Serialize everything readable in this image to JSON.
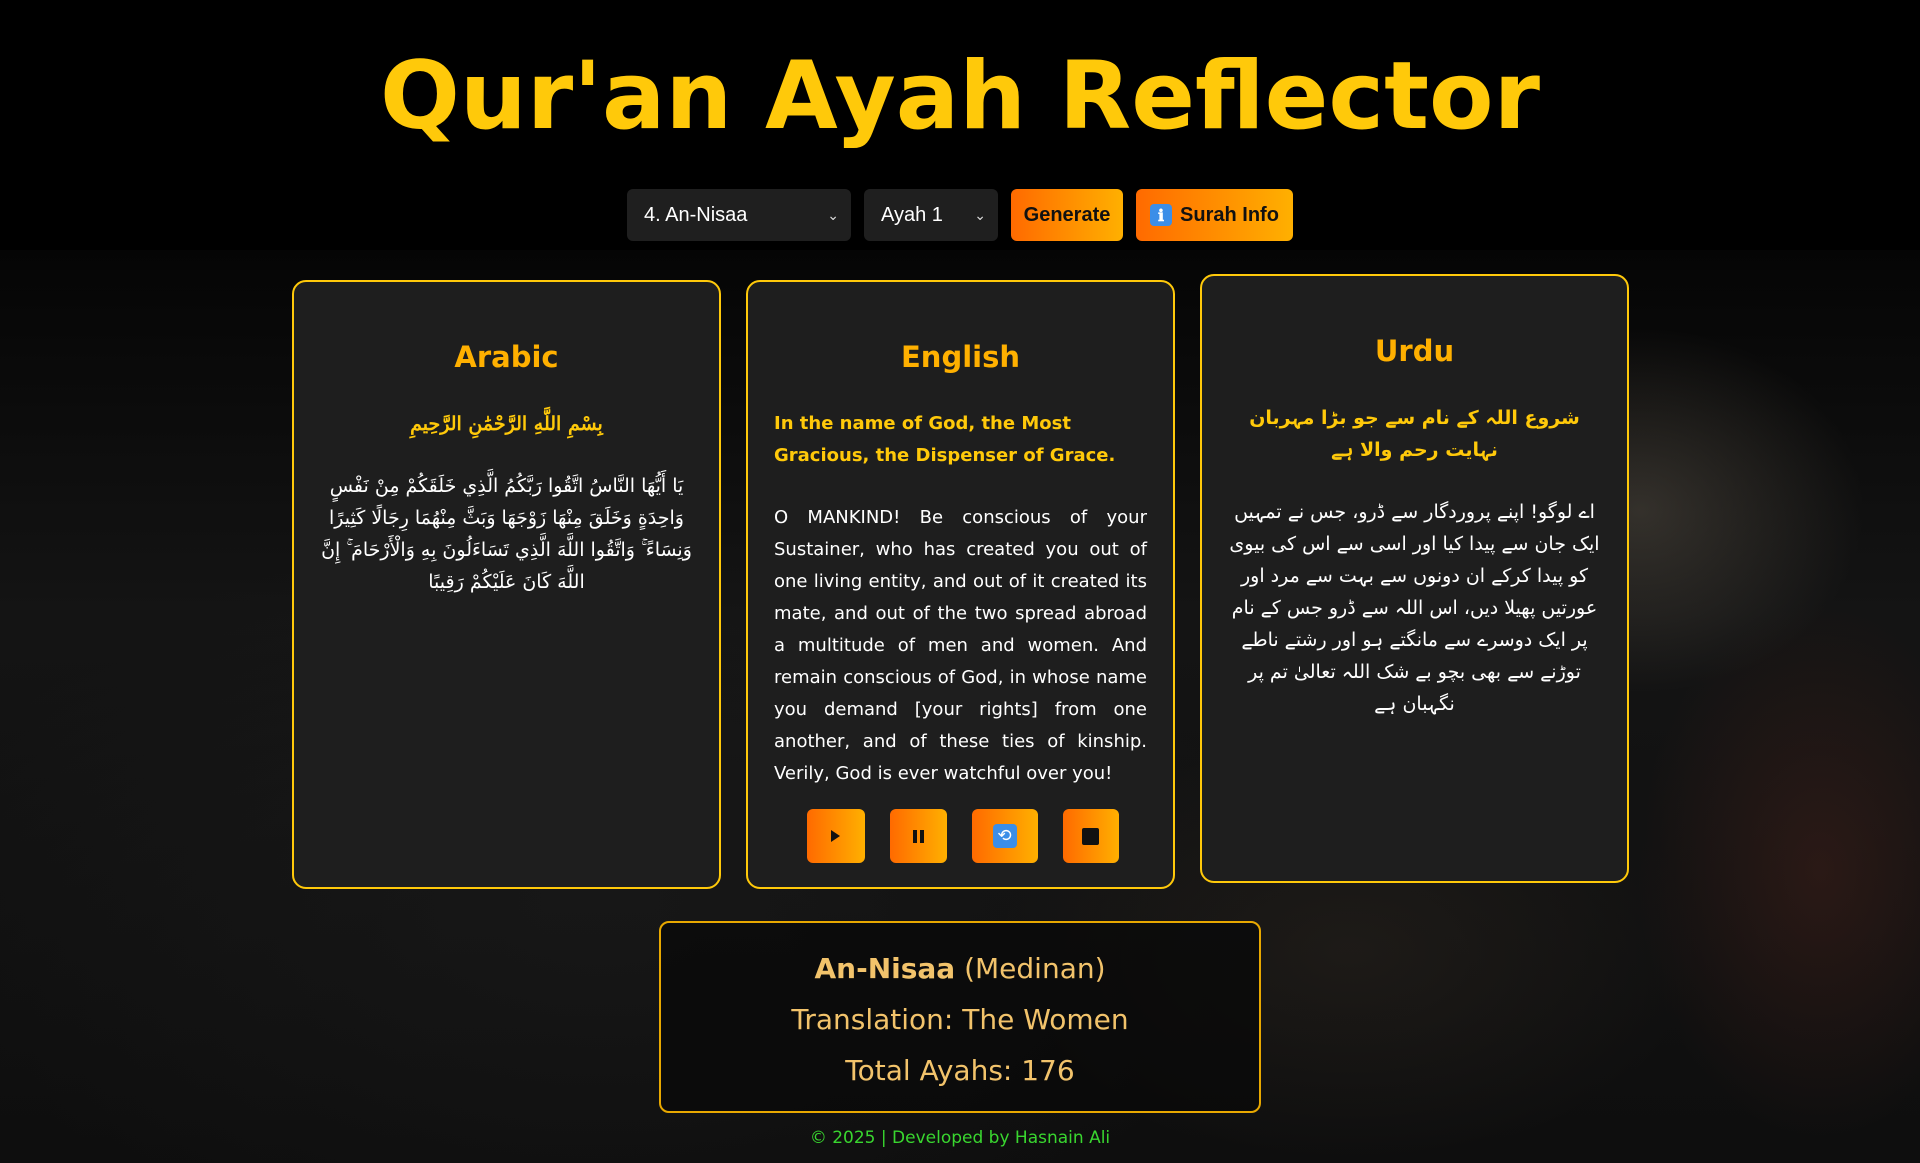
{
  "app": {
    "title": "Qur'an Ayah Reflector"
  },
  "controls": {
    "surah_selected": "4. An-Nisaa",
    "ayah_selected": "Ayah 1",
    "generate_label": "Generate",
    "surah_info_label": "Surah Info",
    "surah_info_icon": "ℹ"
  },
  "cards": {
    "arabic": {
      "heading": "Arabic",
      "bismillah": "بِسْمِ اللَّهِ الرَّحْمَٰنِ الرَّحِيمِ",
      "text": "يَا أَيُّهَا النَّاسُ اتَّقُوا رَبَّكُمُ الَّذِي خَلَقَكُمْ مِنْ نَفْسٍ وَاحِدَةٍ وَخَلَقَ مِنْهَا زَوْجَهَا وَبَثَّ مِنْهُمَا رِجَالًا كَثِيرًا وَنِسَاءً ۚ وَاتَّقُوا اللَّهَ الَّذِي تَسَاءَلُونَ بِهِ وَالْأَرْحَامَ ۚ إِنَّ اللَّهَ كَانَ عَلَيْكُمْ رَقِيبًا"
    },
    "english": {
      "heading": "English",
      "bismillah": "In the name of God, the Most Gracious, the Dispenser of Grace.",
      "text": "O MANKIND! Be conscious of your Sustainer, who has created you out of one living entity, and out of it created its mate, and out of the two spread abroad a multitude of men and women. And remain conscious of God, in whose name you demand [your rights] from one another, and of these ties of kinship. Verily, God is ever watchful over you!"
    },
    "urdu": {
      "heading": "Urdu",
      "bismillah": "شروع اللہ کے نام سے جو بڑا مہربان نہایت رحم والا ہے",
      "text": "اے لوگو! اپنے پروردگار سے ڈرو، جس نے تمہیں ایک جان سے پیدا کیا اور اسی سے اس کی بیوی کو پیدا کرکے ان دونوں سے بہت سے مرد اور عورتیں پھیلا دیں، اس اللہ سے ڈرو جس کے نام پر ایک دوسرے سے مانگتے ہو اور رشتے ناطے توڑنے سے بھی بچو بے شک اللہ تعالیٰ تم پر نگہبان ہے"
    }
  },
  "audio": {
    "play_icon": "play-icon",
    "pause_icon": "pause-icon",
    "loop_icon": "repeat-icon",
    "loop_glyph": "🔁",
    "stop_icon": "stop-icon"
  },
  "surah_info": {
    "name": "An-Nisaa",
    "type": "(Medinan)",
    "translation": "Translation: The Women",
    "total": "Total Ayahs: 176"
  },
  "footer": {
    "text": "© 2025 | Developed by Hasnain Ali"
  },
  "colors": {
    "accent": "#ffc90a",
    "button_start": "#ff6a00",
    "button_end": "#ffb000",
    "footer": "#39d62f"
  }
}
